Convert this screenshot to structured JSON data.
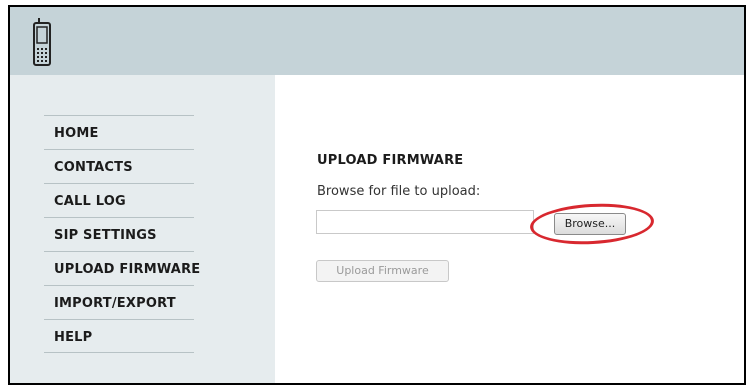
{
  "header": {
    "icon": "phone-icon"
  },
  "sidebar": {
    "items": [
      {
        "label": "HOME"
      },
      {
        "label": "CONTACTS"
      },
      {
        "label": "CALL LOG"
      },
      {
        "label": "SIP SETTINGS"
      },
      {
        "label": "UPLOAD FIRMWARE"
      },
      {
        "label": "IMPORT/EXPORT"
      },
      {
        "label": "HELP"
      }
    ]
  },
  "main": {
    "title": "UPLOAD FIRMWARE",
    "browse_label": "Browse for file to upload:",
    "file_value": "",
    "browse_button": "Browse...",
    "upload_button": "Upload Firmware"
  },
  "colors": {
    "header_bg": "#c5d3d8",
    "sidebar_bg": "#e6ecee",
    "highlight": "#d8282f"
  }
}
